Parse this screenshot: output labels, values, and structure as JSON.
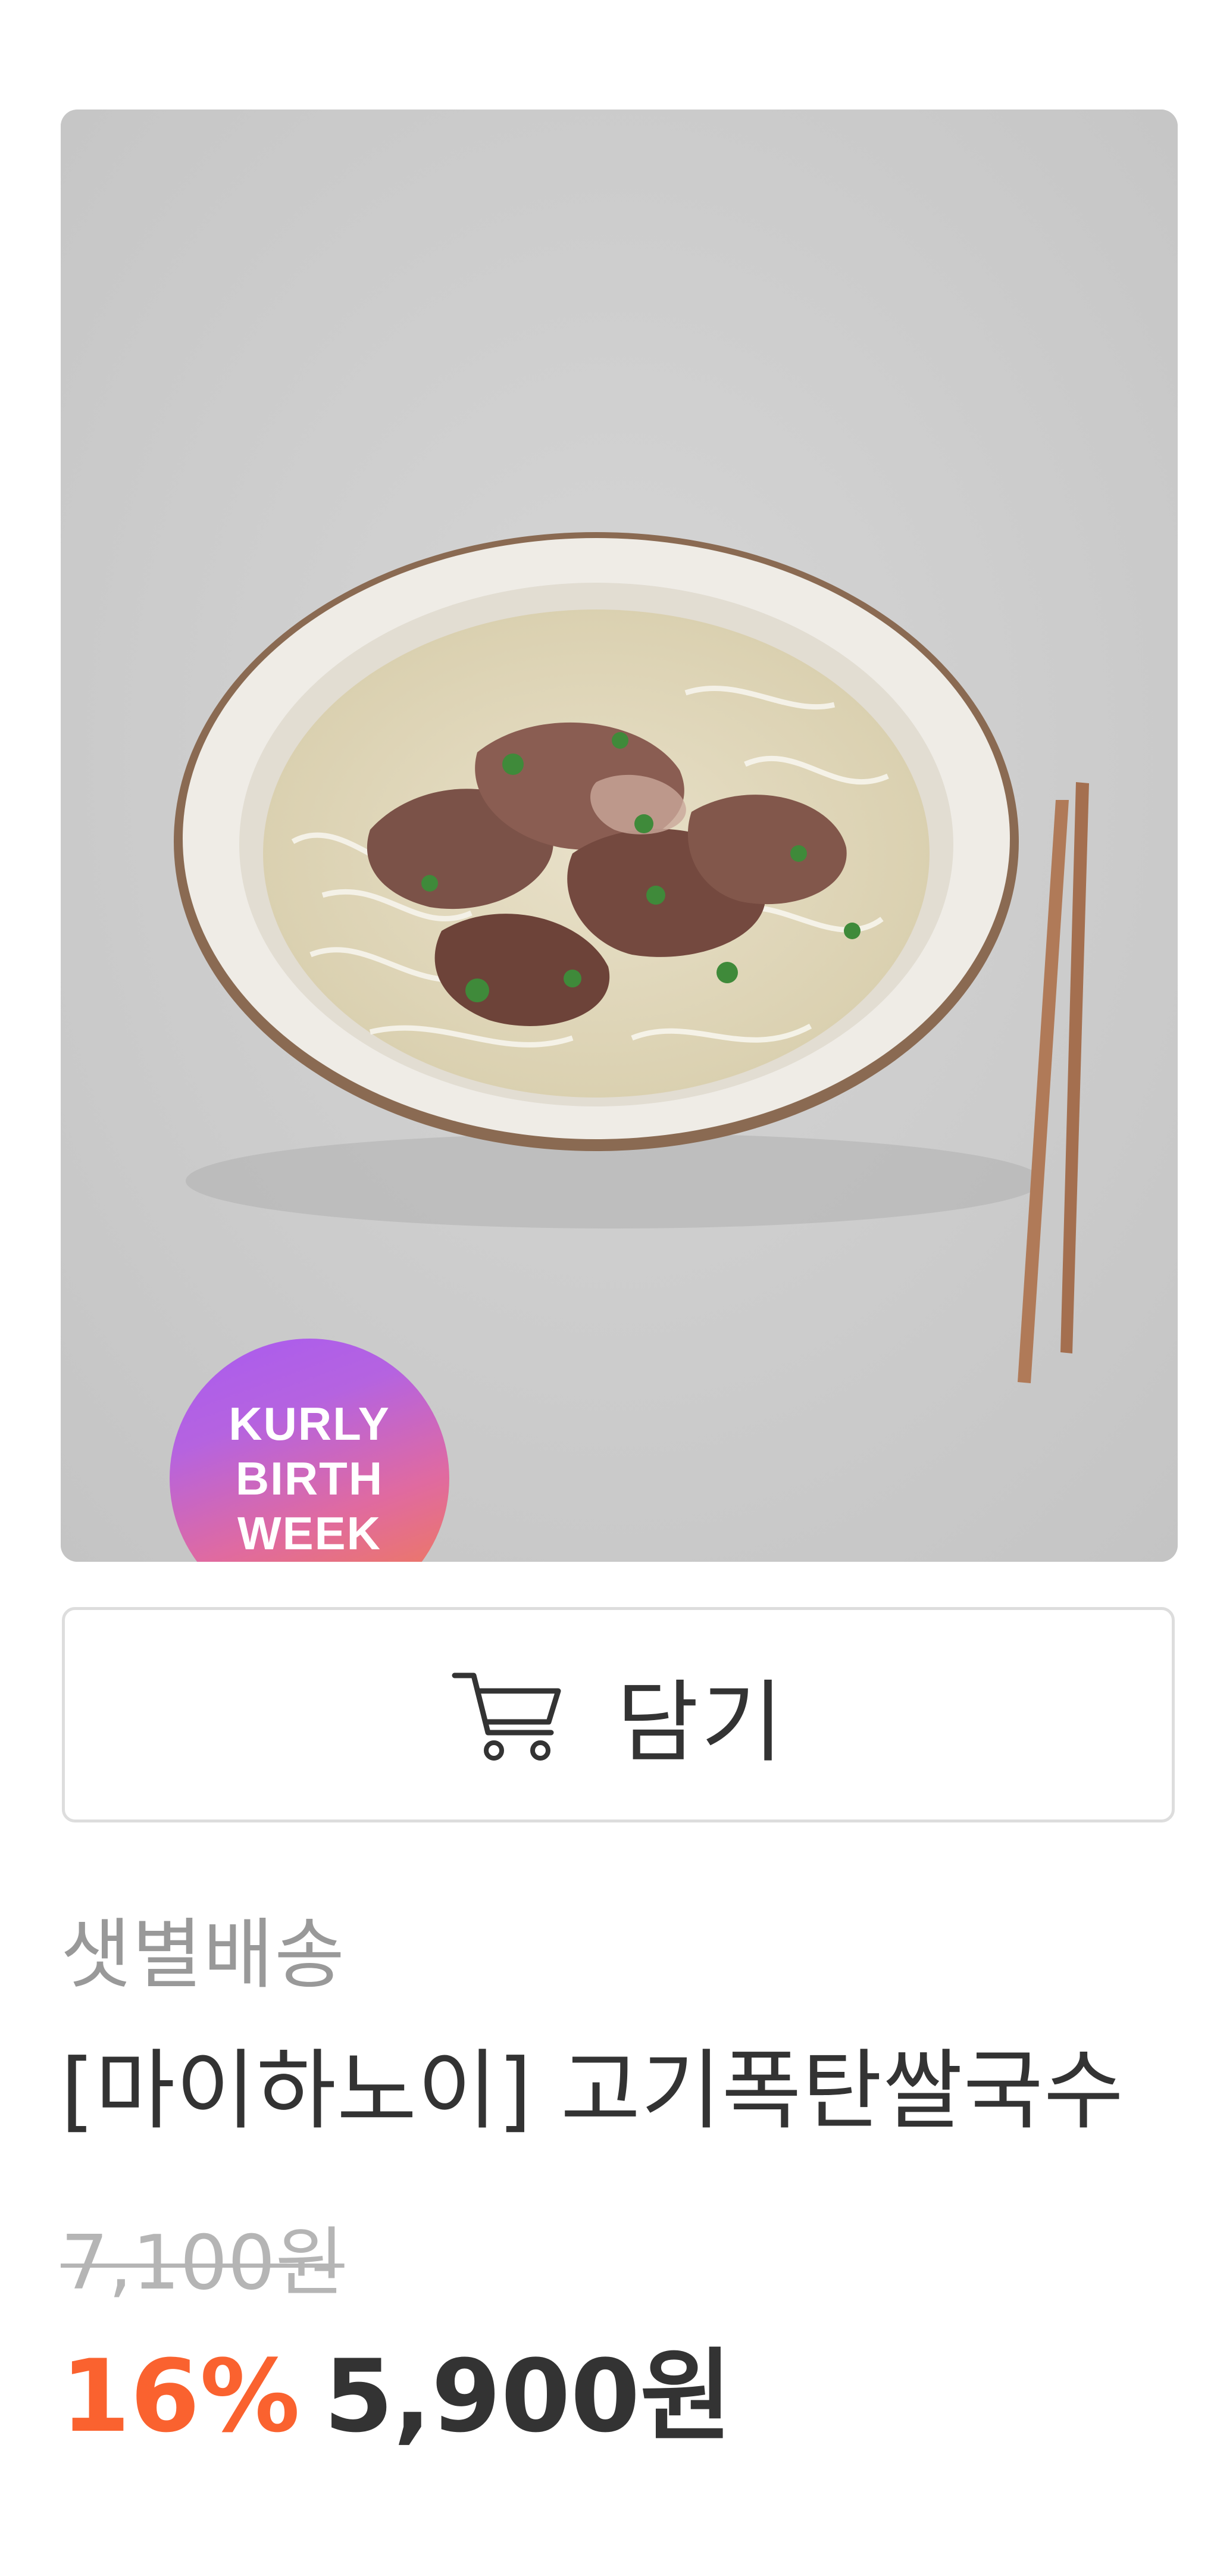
{
  "product": {
    "badge": {
      "lines": [
        "KURLY",
        "BIRTH",
        "WEEK"
      ]
    },
    "cart_button": {
      "label": "담기",
      "icon": "cart-icon"
    },
    "delivery_type": "샛별배송",
    "name": "[마이하노이] 고기폭탄쌀국수",
    "original_price": "7,100원",
    "discount_rate": "16%",
    "sale_price": "5,900원"
  },
  "colors": {
    "discount": "#fa622f",
    "text_primary": "#333333",
    "text_muted": "#999999",
    "border": "#dddddd"
  }
}
